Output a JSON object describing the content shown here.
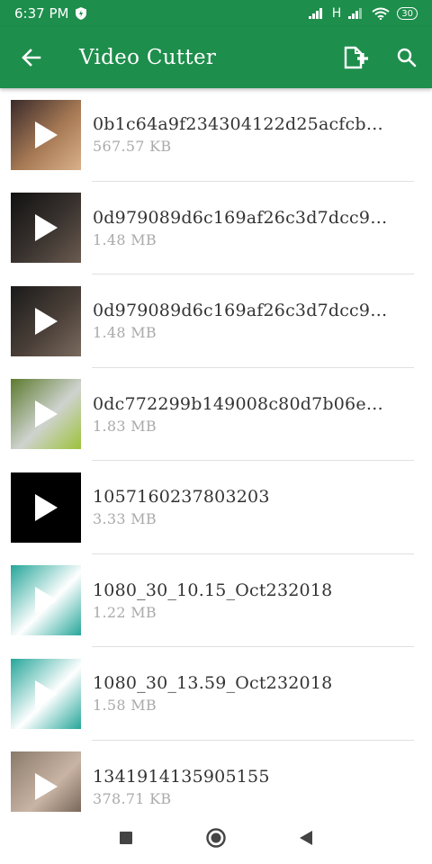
{
  "status": {
    "time": "6:37 PM",
    "network": "H",
    "battery": "30"
  },
  "app_bar": {
    "title": "Video Cutter"
  },
  "videos": [
    {
      "name": "0b1c64a9f234304122d25acfcb…",
      "size": "567.57 KB",
      "thumb_colors": [
        "#3a2a2a",
        "#a77a55",
        "#d9b08a"
      ]
    },
    {
      "name": "0d979089d6c169af26c3d7dcc9…",
      "size": "1.48 MB",
      "thumb_colors": [
        "#111111",
        "#3b3430",
        "#6b5b50"
      ]
    },
    {
      "name": "0d979089d6c169af26c3d7dcc9…",
      "size": "1.48 MB",
      "thumb_colors": [
        "#1a1a1a",
        "#4a3f38",
        "#7a6a5e"
      ]
    },
    {
      "name": "0dc772299b149008c80d7b06e…",
      "size": "1.83 MB",
      "thumb_colors": [
        "#5c7a2e",
        "#cfd3cf",
        "#9cc23a"
      ]
    },
    {
      "name": "1057160237803203",
      "size": "3.33 MB",
      "thumb_colors": [
        "#000000",
        "#000000",
        "#000000"
      ]
    },
    {
      "name": "1080_30_10.15_Oct232018",
      "size": "1.22 MB",
      "thumb_colors": [
        "#25a69a",
        "#ffffff",
        "#25a69a"
      ]
    },
    {
      "name": "1080_30_13.59_Oct232018",
      "size": "1.58 MB",
      "thumb_colors": [
        "#25a69a",
        "#ffffff",
        "#25a69a"
      ]
    },
    {
      "name": "1341914135905155",
      "size": "378.71 KB",
      "thumb_colors": [
        "#8a7a6a",
        "#c9b4a4",
        "#6a5a4e"
      ]
    }
  ],
  "icons": {
    "back": "arrow-left-icon",
    "add_file": "add-file-icon",
    "search": "search-icon",
    "play": "play-icon",
    "nav_recents": "square-icon",
    "nav_home": "circle-icon",
    "nav_back": "triangle-icon"
  },
  "colors": {
    "primary": "#1e8e4c",
    "divider": "#e0e0e0",
    "secondary_text": "#aaaaaa"
  }
}
